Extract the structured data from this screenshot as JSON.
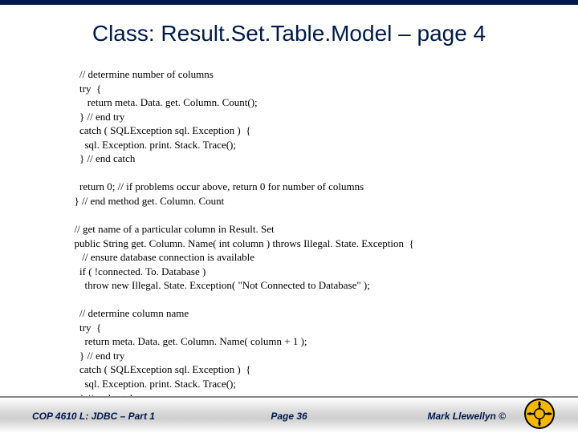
{
  "title": "Class:  Result.Set.Table.Model – page 4",
  "code": "    // determine number of columns\n    try  {\n       return meta. Data. get. Column. Count();\n    } // end try\n    catch ( SQLException sql. Exception )  {\n      sql. Exception. print. Stack. Trace();\n    } // end catch\n\n    return 0; // if problems occur above, return 0 for number of columns\n  } // end method get. Column. Count\n\n  // get name of a particular column in Result. Set\n  public String get. Column. Name( int column ) throws Illegal. State. Exception  {\n     // ensure database connection is available\n    if ( !connected. To. Database )\n      throw new Illegal. State. Exception( \"Not Connected to Database\" );\n\n    // determine column name\n    try  {\n      return meta. Data. get. Column. Name( column + 1 );\n    } // end try\n    catch ( SQLException sql. Exception )  {\n      sql. Exception. print. Stack. Trace();\n    } // end catch",
  "footer": {
    "left": "COP 4610 L: JDBC – Part 1",
    "center": "Page 36",
    "right": "Mark Llewellyn ©"
  }
}
